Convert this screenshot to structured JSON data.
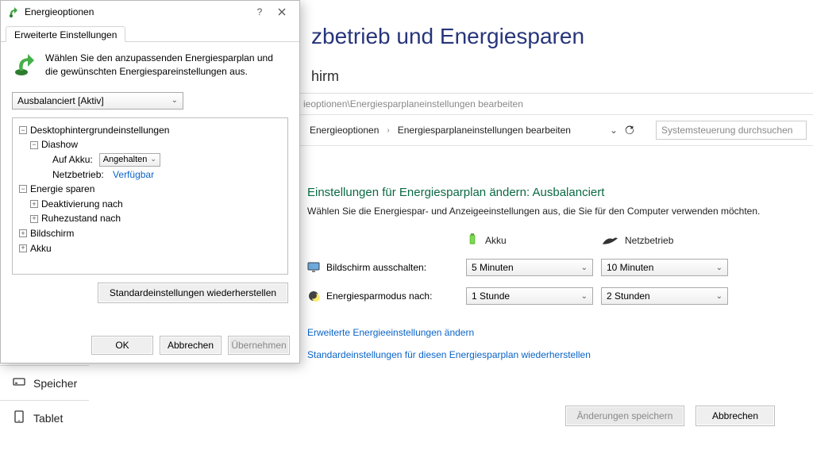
{
  "page": {
    "title_partial": "zbetrieb und Energiesparen",
    "subtitle_partial": "hirm",
    "path_partial": "ieoptionen\\Energiesparplaneinstellungen bearbeiten",
    "crumbs": {
      "a": "Energieoptionen",
      "b": "Energiesparplaneinstellungen bearbeiten"
    },
    "search_placeholder": "Systemsteuerung durchsuchen",
    "plan": {
      "heading": "Einstellungen für Energiesparplan ändern: Ausbalanciert",
      "description": "Wählen Sie die Energiespar- und Anzeigeeinstellungen aus, die Sie für den Computer verwenden möchten.",
      "col_batt": "Akku",
      "col_ac": "Netzbetrieb",
      "row_display": "Bildschirm ausschalten:",
      "row_sleep": "Energiesparmodus nach:",
      "display_batt": "5 Minuten",
      "display_ac": "10 Minuten",
      "sleep_batt": "1 Stunde",
      "sleep_ac": "2 Stunden",
      "link_advanced": "Erweiterte Energieeinstellungen ändern",
      "link_restore": "Standardeinstellungen für diesen Energiesparplan wiederherstellen",
      "save": "Änderungen speichern",
      "cancel": "Abbrechen"
    },
    "sidebar": {
      "storage": "Speicher",
      "tablet": "Tablet"
    }
  },
  "dialog": {
    "title": "Energieoptionen",
    "tab": "Erweiterte Einstellungen",
    "intro": "Wählen Sie den anzupassenden Energiesparplan und die gewünschten Energiespareinstellungen aus.",
    "plan_selector": "Ausbalanciert [Aktiv]",
    "tree": {
      "node_desktop_bg": "Desktophintergrundeinstellungen",
      "node_diashow": "Diashow",
      "prop_on_batt": "Auf Akku:",
      "prop_on_batt_val": "Angehalten",
      "prop_ac": "Netzbetrieb:",
      "prop_ac_val": "Verfügbar",
      "node_save": "Energie sparen",
      "node_deact": "Deaktivierung nach",
      "node_hibernate": "Ruhezustand nach",
      "node_display": "Bildschirm",
      "node_batt": "Akku"
    },
    "restore_defaults": "Standardeinstellungen wiederherstellen",
    "ok": "OK",
    "cancel": "Abbrechen",
    "apply": "Übernehmen"
  }
}
